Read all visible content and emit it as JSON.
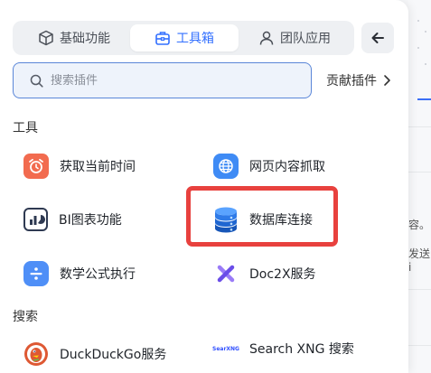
{
  "tabs": [
    {
      "label": "基础功能",
      "icon": "cube-icon"
    },
    {
      "label": "工具箱",
      "icon": "toolbox-icon",
      "active": true
    },
    {
      "label": "团队应用",
      "icon": "user-icon"
    }
  ],
  "back_icon": "arrow-left-icon",
  "search": {
    "placeholder": "搜索插件"
  },
  "contribute": {
    "label": "贡献插件"
  },
  "sections": {
    "tools": "工具",
    "search": "搜索"
  },
  "tools": [
    {
      "label": "获取当前时间",
      "icon": "alarm-clock-icon",
      "color": "#f26b4f"
    },
    {
      "label": "网页内容抓取",
      "icon": "globe-icon",
      "color": "#3f8bf5"
    },
    {
      "label": "BI图表功能",
      "icon": "bi-chart-icon",
      "color": "#2f3a52"
    },
    {
      "label": "数据库连接",
      "icon": "database-icon",
      "color": "#2f7be8"
    },
    {
      "label": "数学公式执行",
      "icon": "divide-icon",
      "color": "#4f8ff7"
    },
    {
      "label": "Doc2X服务",
      "icon": "doc2x-logo-icon",
      "color": "#7b5cf0"
    }
  ],
  "search_tools": [
    {
      "label": "DuckDuckGo服务",
      "icon": "duckduckgo-icon",
      "color": "#de5833"
    },
    {
      "label": "Search XNG 搜索",
      "icon": "searxng-logo-icon",
      "logo_text": "SearXNG",
      "color": "#3050ff"
    }
  ],
  "background": {
    "text_1": "容。",
    "text_2": "发送i"
  }
}
